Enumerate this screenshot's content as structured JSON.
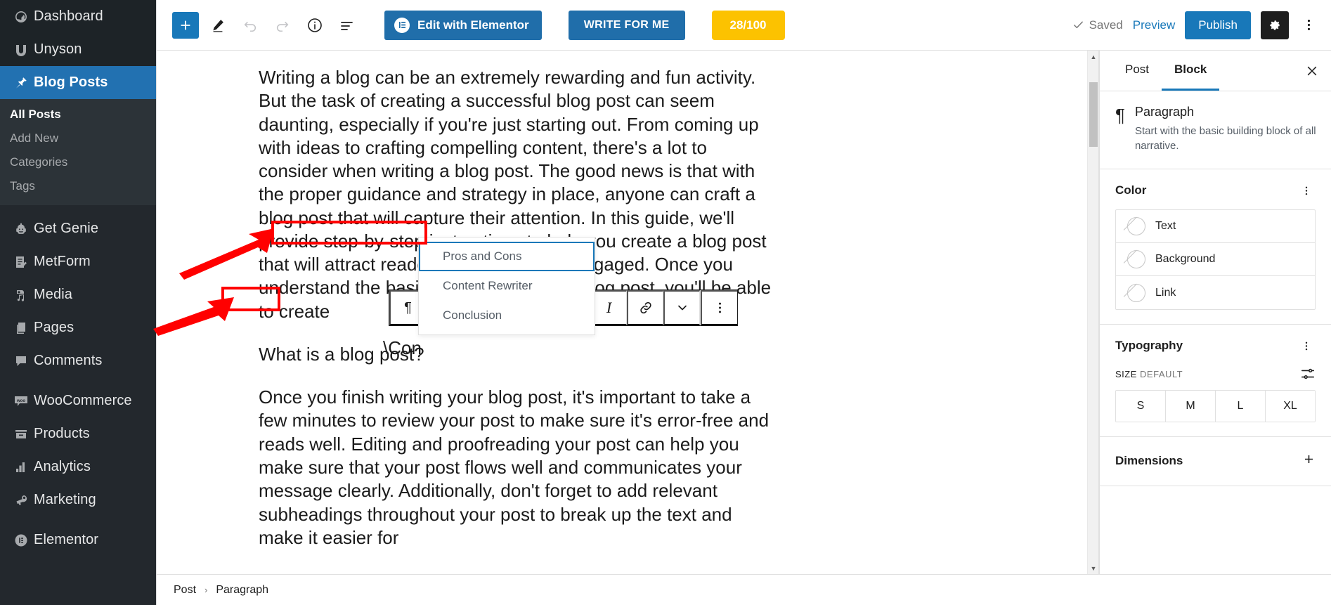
{
  "admin_sidebar": {
    "items": [
      {
        "label": "Dashboard",
        "icon": "dashboard-icon",
        "state": "normal"
      },
      {
        "label": "Unyson",
        "icon": "unyson-icon",
        "state": "normal"
      },
      {
        "label": "Blog Posts",
        "icon": "pin-icon",
        "state": "current"
      }
    ],
    "submenu": [
      {
        "label": "All Posts",
        "state": "current"
      },
      {
        "label": "Add New",
        "state": "normal"
      },
      {
        "label": "Categories",
        "state": "normal"
      },
      {
        "label": "Tags",
        "state": "normal"
      }
    ],
    "items_2": [
      {
        "label": "Get Genie",
        "icon": "robot-icon"
      },
      {
        "label": "MetForm",
        "icon": "form-icon"
      },
      {
        "label": "Media",
        "icon": "media-icon"
      },
      {
        "label": "Pages",
        "icon": "pages-icon"
      },
      {
        "label": "Comments",
        "icon": "comments-icon"
      }
    ],
    "items_3": [
      {
        "label": "WooCommerce",
        "icon": "woo-icon"
      },
      {
        "label": "Products",
        "icon": "products-icon"
      },
      {
        "label": "Analytics",
        "icon": "analytics-icon"
      },
      {
        "label": "Marketing",
        "icon": "megaphone-icon"
      }
    ],
    "items_4": [
      {
        "label": "Elementor",
        "icon": "elementor-icon"
      }
    ]
  },
  "header": {
    "add_block_label": "+",
    "tools": [
      {
        "name": "add-block-button",
        "icon": "plus-icon"
      },
      {
        "name": "edit-tool-button",
        "icon": "pencil-icon"
      },
      {
        "name": "undo-button",
        "icon": "undo-arrow-icon"
      },
      {
        "name": "redo-button",
        "icon": "redo-arrow-icon"
      },
      {
        "name": "details-button",
        "icon": "info-circle-icon"
      },
      {
        "name": "list-view-button",
        "icon": "list-view-icon"
      }
    ],
    "edit_with_elementor": "Edit with Elementor",
    "write_for_me": "WRITE FOR ME",
    "score_badge": "28/100",
    "saved_label": "Saved",
    "preview_label": "Preview",
    "publish_label": "Publish",
    "settings_icon": "gear-icon",
    "more_icon": "kebab-menu-icon"
  },
  "content": {
    "paragraphs": [
      "Writing a blog can be an extremely rewarding and fun activity. But the task of creating a successful blog post can seem daunting, especially if you're just starting out. From coming up with ideas to crafting compelling content, there's a lot to consider when writing a blog post. The good news is that with the proper guidance and strategy in place, anyone can craft a blog post that will capture their attention. In this guide, we'll provide step-by-step instructions to help you create a blog post that will attract readers and keep them engaged. Once you understand the basics of how to write a blog post, you'll be able to create",
      "What is a blog post?",
      "Once you finish writing your blog post, it's important to take a few minutes to review your post to make sure it's error-free and reads well. Editing and proofreading your post can help you make sure that your post flows well and communicates your message clearly. Additionally, don't forget to add relevant subheadings throughout your post to break up the text and make it easier for"
    ],
    "typed_command": "\\Con"
  },
  "slash_menu": {
    "options": [
      {
        "label": "Pros and Cons",
        "highlight": "blue"
      },
      {
        "label": "Content Rewriter",
        "highlight": "red"
      },
      {
        "label": "Conclusion",
        "highlight": "none"
      }
    ]
  },
  "block_toolbar": {
    "buttons": [
      {
        "name": "block-type-paragraph-button",
        "glyph": "¶"
      },
      {
        "name": "italic-button",
        "glyph": "I"
      },
      {
        "name": "link-button",
        "glyph": "link-icon"
      },
      {
        "name": "more-formatting-button",
        "glyph": "chevron-down-icon"
      },
      {
        "name": "block-options-button",
        "glyph": "kebab-menu-icon"
      }
    ]
  },
  "settings_sidebar": {
    "tabs": [
      {
        "label": "Post",
        "active": false
      },
      {
        "label": "Block",
        "active": true
      }
    ],
    "close_icon": "close-icon",
    "block": {
      "icon": "paragraph-pilcrow-icon",
      "title": "Paragraph",
      "description": "Start with the basic building block of all narrative."
    },
    "color": {
      "title": "Color",
      "more_icon": "kebab-menu-icon",
      "rows": [
        {
          "label": "Text",
          "swatch": "none"
        },
        {
          "label": "Background",
          "swatch": "none"
        },
        {
          "label": "Link",
          "swatch": "none"
        }
      ]
    },
    "typography": {
      "title": "Typography",
      "more_icon": "kebab-menu-icon",
      "size_label": "SIZE",
      "size_value": "DEFAULT",
      "tune_icon": "sliders-icon",
      "sizes": [
        "S",
        "M",
        "L",
        "XL"
      ]
    },
    "dimensions": {
      "title": "Dimensions",
      "add_icon": "plus-icon"
    }
  },
  "breadcrumb": {
    "items": [
      "Post",
      "Paragraph"
    ],
    "separator": "›"
  },
  "scrollbar": {
    "up_arrow": "▲",
    "down_arrow": "▼"
  },
  "colors": {
    "admin_bg": "#23282d",
    "admin_current": "#2271b1",
    "accent_blue": "#1878b9",
    "elementor_blue": "#206eaa",
    "score_yellow": "#fcc200",
    "annotation_red": "#ff0000",
    "highlight_blue": "#1878b9"
  }
}
